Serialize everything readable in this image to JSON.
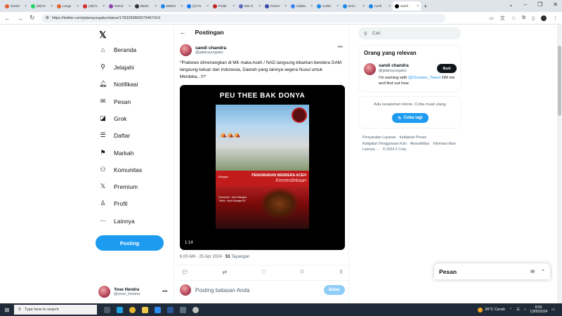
{
  "browser": {
    "tabs": [
      {
        "label": "Sumbi",
        "color": "#e2622f"
      },
      {
        "label": "(69) N",
        "color": "#25d366"
      },
      {
        "label": "Langs",
        "color": "#e2622f"
      },
      {
        "label": "(48) N",
        "color": "#d32f2f"
      },
      {
        "label": "Gema",
        "color": "#8e44ad"
      },
      {
        "label": "BEZZ",
        "color": "#333333"
      },
      {
        "label": "BMKG",
        "color": "#1e88e5"
      },
      {
        "label": "(2) Fa",
        "color": "#1877f2"
      },
      {
        "label": "Pulah",
        "color": "#c62828"
      },
      {
        "label": "504 G",
        "color": "#5c6bc0"
      },
      {
        "label": "Kemer",
        "color": "#3949ab"
      },
      {
        "label": "sakalu",
        "color": "#4285f4"
      },
      {
        "label": "Cekfa",
        "color": "#1e88e5"
      },
      {
        "label": "DAU",
        "color": "#1e88e5"
      },
      {
        "label": "Aceh",
        "color": "#1e88e5"
      },
      {
        "label": "sandi",
        "color": "#000000",
        "active": true
      }
    ],
    "new_tab": "+",
    "url": "https://twitter.com/jalansyurgaku/status/1783269883079467419"
  },
  "sidebar": {
    "logo": "𝕏",
    "items": [
      {
        "label": "Beranda",
        "icon": "home-icon",
        "glyph": "⌂"
      },
      {
        "label": "Jelajahi",
        "icon": "search-icon",
        "glyph": "⚲"
      },
      {
        "label": "Notifikasi",
        "icon": "bell-icon",
        "glyph": "🔔︎"
      },
      {
        "label": "Pesan",
        "icon": "mail-icon",
        "glyph": "✉"
      },
      {
        "label": "Grok",
        "icon": "grok-icon",
        "glyph": "◪"
      },
      {
        "label": "Daftar",
        "icon": "list-icon",
        "glyph": "☰"
      },
      {
        "label": "Markah",
        "icon": "bookmark-icon",
        "glyph": "⚑"
      },
      {
        "label": "Komunitas",
        "icon": "community-icon",
        "glyph": "⚇"
      },
      {
        "label": "Premium",
        "icon": "x-premium-icon",
        "glyph": "𝕏"
      },
      {
        "label": "Profil",
        "icon": "profile-icon",
        "glyph": "♙"
      },
      {
        "label": "Lainnya",
        "icon": "more-circle-icon",
        "glyph": "⋯"
      }
    ],
    "post_button": "Posting",
    "user": {
      "name": "Yose Hendra",
      "handle": "@yose_hendra"
    }
  },
  "main": {
    "header": "Postingan",
    "author": {
      "name": "sandi chandra",
      "handle": "@jalansyurgaku"
    },
    "text": "*Prabowo dimenangkan di MK maka Aceh / NAD langsung kibarkan bendera GAM langsung keluar dari Indonesia, Daerah yang lainnya segera Nusul untuk Merdeka...!!!*",
    "video": {
      "title": "PEU THEE BAK DONYA",
      "banner": "PENGIBARAN BENDERA ACEH",
      "banner_script": "Kemerdekaan",
      "corner_label": "Bangsa",
      "poster_info": [
        "Facebook : Aceh Bangsa",
        "Tiktok : Aceh Bangsa 51"
      ],
      "duration": "1:14"
    },
    "meta": {
      "time": "6.00 AM · 25 Apr 2024 ·",
      "views": "51",
      "views_label": "Tayangan"
    },
    "reply_placeholder": "Posting balasan Anda",
    "reply_button": "Balas"
  },
  "right": {
    "search_placeholder": "Cari",
    "relevant": {
      "title": "Orang yang relevan",
      "name": "sandi chandra",
      "handle": "@jalansyurgaku",
      "follow": "Ikuti",
      "bio_pre": "I'm earning with ",
      "bio_link": "@Cheelee_Tweet",
      "bio_post": " DM me and find out how."
    },
    "error": {
      "text": "Ada kesalahan teknis. Coba muat ulang.",
      "retry": "Coba lagi"
    },
    "footer": [
      "Persyaratan Layanan",
      "Kebijakan Privasi",
      "Kebijakan Penggunaan Kuki",
      "Aksesibilitas",
      "Informasi Iklan",
      "Lainnya ···",
      "© 2024 X Corp."
    ]
  },
  "dm": {
    "title": "Pesan"
  },
  "taskbar": {
    "search": "Type here to search",
    "weather": "26°C  Cerah",
    "time": "8:55",
    "date": "13/05/2024"
  }
}
